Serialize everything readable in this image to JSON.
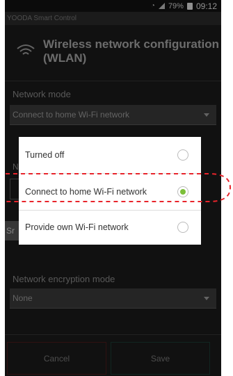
{
  "status": {
    "battery": "79%",
    "time": "09:12"
  },
  "app": {
    "title": "YOODA Smart Control"
  },
  "header": {
    "title_line1": "Wireless network configuration",
    "title_line2": "(WLAN)"
  },
  "network_mode": {
    "label": "Network mode",
    "value": "Connect to home Wi-Fi network"
  },
  "partial": {
    "name_label": "Na",
    "side": "Sr"
  },
  "dialog": {
    "options": [
      {
        "label": "Turned off",
        "selected": false
      },
      {
        "label": "Connect to home Wi-Fi network",
        "selected": true
      },
      {
        "label": "Provide own Wi-Fi network",
        "selected": false
      }
    ]
  },
  "encryption": {
    "label": "Network encryption mode",
    "value": "None"
  },
  "buttons": {
    "cancel": "Cancel",
    "save": "Save"
  },
  "colors": {
    "accent_radio": "#7cbf3a",
    "annotation": "#e8242b"
  }
}
